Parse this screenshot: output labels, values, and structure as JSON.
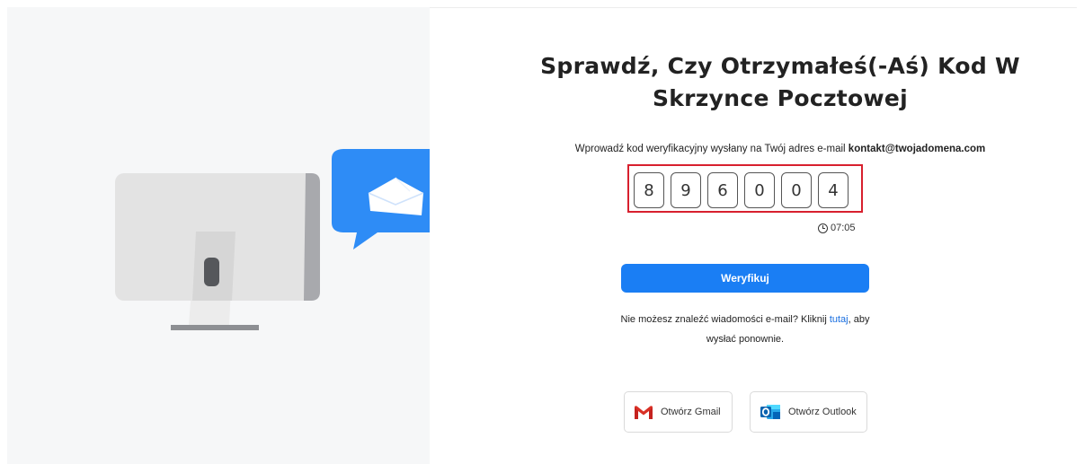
{
  "heading": {
    "line1": "Sprawdź, Czy Otrzymałeś(-Aś) Kod W",
    "line2": "Skrzynce Pocztowej"
  },
  "instruction": {
    "prefix": "Wprowadź kod weryfikacyjny wysłany na Twój adres e-mail",
    "email": "kontakt@twojadomena.com"
  },
  "code": {
    "digits": [
      "8",
      "9",
      "6",
      "0",
      "0",
      "4"
    ]
  },
  "timer": {
    "value": "07:05",
    "icon": "clock-icon"
  },
  "verify_button": {
    "label": "Weryfikuj"
  },
  "resend": {
    "text_before": "Nie możesz znaleźć wiadomości e-mail? Kliknij",
    "link": "tutaj",
    "text_after": ", aby",
    "line2": "wysłać ponownie."
  },
  "mail_buttons": {
    "gmail": {
      "label": "Otwórz Gmail",
      "icon": "gmail-icon"
    },
    "outlook": {
      "label": "Otwórz Outlook",
      "icon": "outlook-icon"
    }
  },
  "colors": {
    "accent": "#1a7ef4",
    "highlight_frame": "#d8202e",
    "illustration_bubble": "#2e8cf6",
    "left_panel_bg": "#f6f7f8"
  }
}
